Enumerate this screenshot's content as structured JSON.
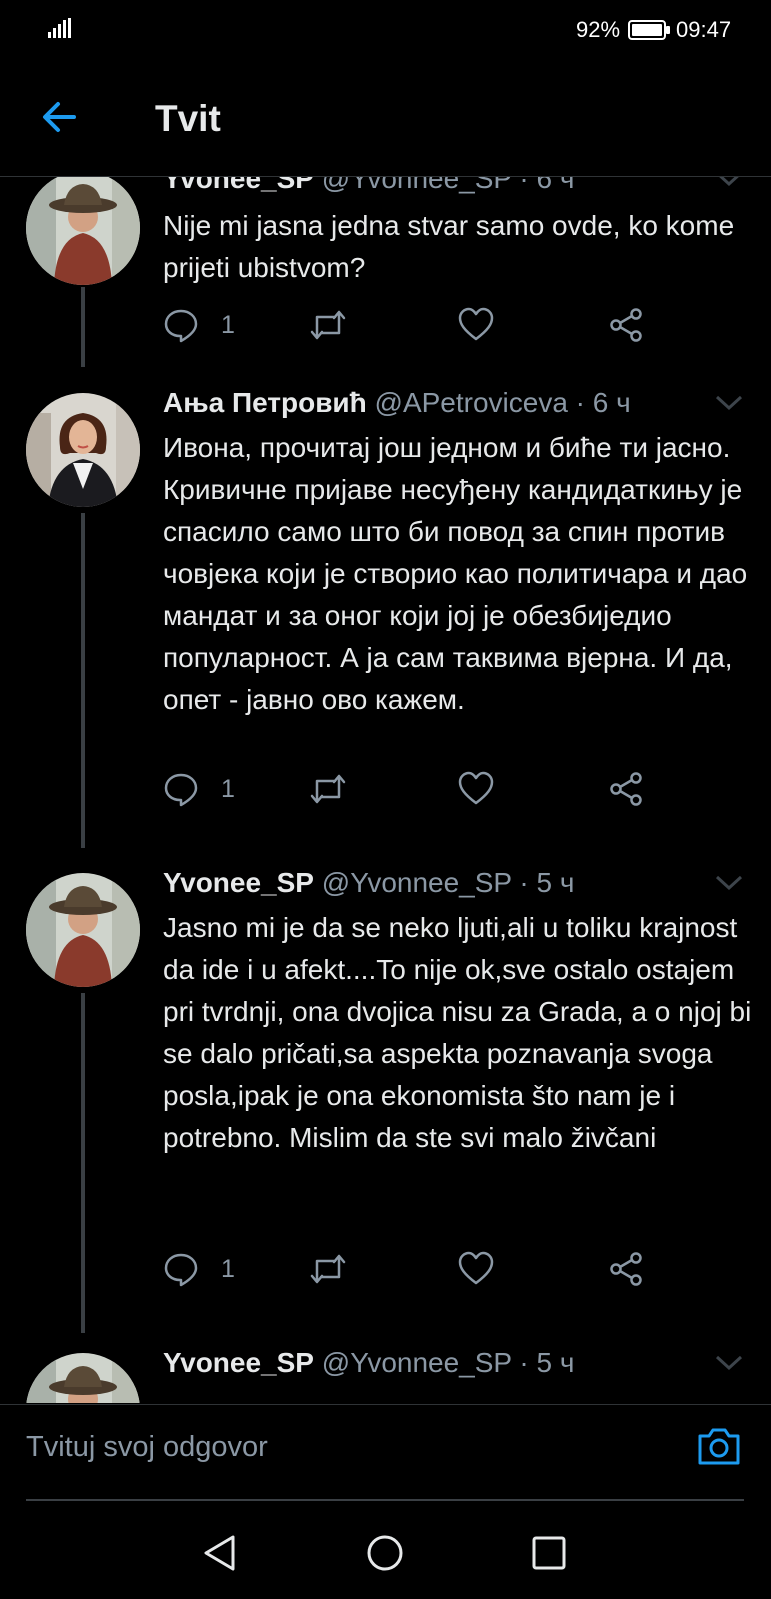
{
  "status_bar": {
    "battery_percent": "92%",
    "time": "09:47"
  },
  "header": {
    "title": "Tvit"
  },
  "tweets": [
    {
      "name": "Yvonee_SP",
      "meta": "@Yvonnee_SP · 6 ч",
      "text": "Nije mi jasna jedna stvar samo ovde, ko kome prijeti ubistvom?",
      "reply_count": "1"
    },
    {
      "name": "Ања Петровић",
      "meta": "@APetroviceva · 6 ч",
      "text": "Ивона, прочитај још једном и биће ти јасно. Кривичне пријаве несуђену кандидаткињу је спасило само што би повод за спин против човјека који је створио као политичара и дао мандат и за оног који јој је обезбиједио популарност. А ја сам таквима вјерна. И да, опет - јавно ово кажем.",
      "reply_count": "1"
    },
    {
      "name": "Yvonee_SP",
      "meta": "@Yvonnee_SP · 5 ч",
      "text": "Jasno mi je da se neko ljuti,ali u toliku krajnost da ide i u afekt....To nije ok,sve ostalo ostajem pri tvrdnji, ona dvojica nisu za Grada, a o njoj bi se dalo pričati,sa aspekta poznavanja svoga posla,ipak je ona ekonomista što nam je i potrebno.  Mislim da ste svi malo živčani",
      "reply_count": "1"
    },
    {
      "name": "Yvonee_SP",
      "meta": "@Yvonnee_SP · 5 ч",
      "text": ""
    }
  ],
  "composer": {
    "placeholder": "Tvituj svoj odgovor"
  },
  "colors": {
    "accent": "#1d9bf0",
    "muted": "#8b98a5",
    "background": "#000000"
  }
}
